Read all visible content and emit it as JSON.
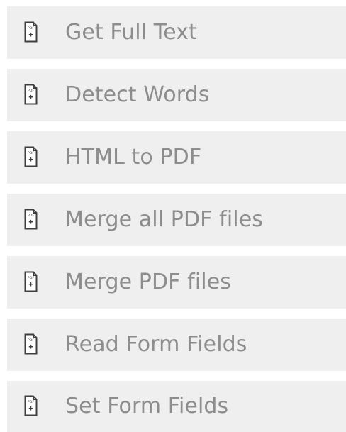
{
  "menu": {
    "items": [
      {
        "label": "Get Full Text",
        "icon": "pdf-file-icon"
      },
      {
        "label": "Detect Words",
        "icon": "pdf-file-icon"
      },
      {
        "label": "HTML to PDF",
        "icon": "pdf-file-icon"
      },
      {
        "label": "Merge all PDF files",
        "icon": "pdf-file-icon"
      },
      {
        "label": "Merge PDF files",
        "icon": "pdf-file-icon"
      },
      {
        "label": "Read Form Fields",
        "icon": "pdf-file-icon"
      },
      {
        "label": "Set Form Fields",
        "icon": "pdf-file-icon"
      }
    ]
  },
  "colors": {
    "item_background": "#efefef",
    "label_text": "#8d8d8d",
    "icon_stroke": "#3f3f3f",
    "page_background": "#ffffff"
  }
}
